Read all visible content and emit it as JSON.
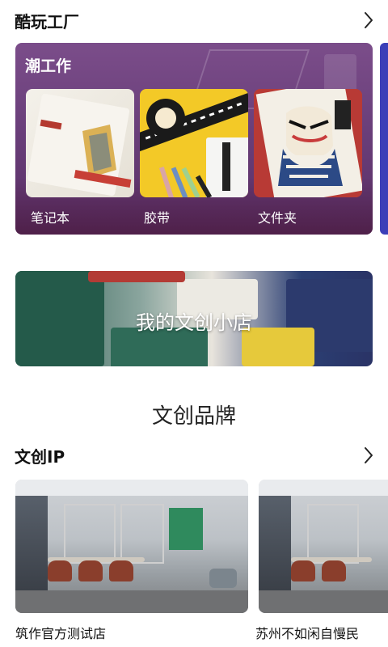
{
  "section_cool": {
    "title": "酷玩工厂"
  },
  "trend": {
    "title": "潮工作",
    "products": [
      {
        "label": "笔记本"
      },
      {
        "label": "胶带"
      },
      {
        "label": "文件夹"
      }
    ]
  },
  "shop_banner": {
    "title": "我的文创小店"
  },
  "brand": {
    "heading": "文创品牌"
  },
  "section_ip": {
    "title": "文创IP"
  },
  "ip_cards": [
    {
      "name": "筑作官方测试店"
    },
    {
      "name": "苏州不如闲自慢民"
    }
  ],
  "colors": {
    "trend_card_bg": "#6a3f7a",
    "peek_card_bg": "#3b3fb8",
    "text_primary": "#111111"
  },
  "icons": {
    "chevron": "chevron-right-icon"
  }
}
